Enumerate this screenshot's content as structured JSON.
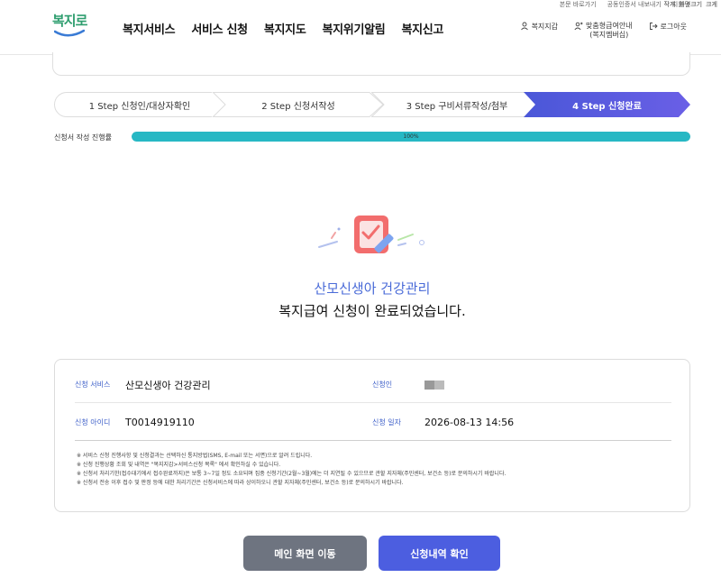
{
  "util_links": [
    "본문 바로가기",
    "공동인증서 내보내기",
    "지원 ∨"
  ],
  "util_right": [
    "작게",
    "화면크기",
    "크게"
  ],
  "logo": {
    "text": "복지로"
  },
  "gnb": [
    "복지서비스",
    "서비스 신청",
    "복지지도",
    "복지위기알림",
    "복지신고"
  ],
  "user_menu": {
    "wallet": "복지지갑",
    "custom_line1": "맞춤형급여안내",
    "custom_line2": "(복지멤버십)",
    "logout": "로그아웃"
  },
  "steps": [
    {
      "label": "1 Step 신청인/대상자확인",
      "active": false
    },
    {
      "label": "2 Step 신청서작성",
      "active": false
    },
    {
      "label": "3 Step 구비서류작성/첨부",
      "active": false
    },
    {
      "label": "4 Step 신청완료",
      "active": true
    }
  ],
  "progress": {
    "label": "신청서 작성 진행률",
    "percent": 100,
    "text": "100%"
  },
  "completion": {
    "service_title": "산모신생아 건강관리",
    "message": "복지급여 신청이 완료되었습니다."
  },
  "info": {
    "service_label": "신청 서비스",
    "service_value": "산모신생아 건강관리",
    "applicant_label": "신청인",
    "id_label": "신청 아이디",
    "id_value": "T0014919110",
    "date_label": "신청 일자",
    "date_value": "2026-08-13 14:56"
  },
  "notes": [
    "※ 서비스 신청 진행사항 및 신청결과는 선택하신 통지방법(SMS, E-mail 또는 서면)으로 알려 드립니다.",
    "※ 신청 진행상황 조회 및 내역은 \"복지지갑>서비스신청 목록\" 에서 확인하실 수 있습니다.",
    "※ 신청서 처리기한(접수대기에서 접수완료까지)은 보통 3~7일 정도 소요되며 집중 신청기간(2월~3월)에는 더 지연될 수 있으므로 관할 지자체(주민센터, 보건소 등)로 문의하시기 바랍니다.",
    "※ 신청서 전송 이후 접수 및 판정 등에 대한 처리기간은 신청서비스에 따라 상이하오니 관할 지자체(주민센터, 보건소 등)로 문의하시기 바랍니다."
  ],
  "buttons": {
    "main": "메인 화면 이동",
    "history": "신청내역 확인"
  },
  "colors": {
    "accent": "#4c5ee0",
    "progress": "#27b8c4",
    "logo": "#2f9e6f",
    "gray_button": "#6e7480"
  }
}
